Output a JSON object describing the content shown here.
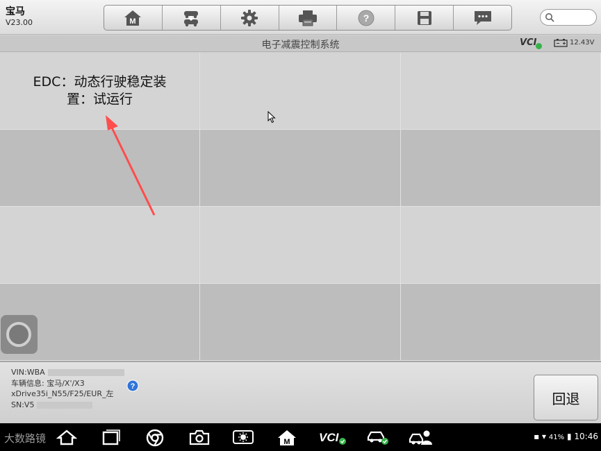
{
  "app": {
    "name": "宝马",
    "version": "V23.00"
  },
  "toolbar": {
    "buttons": [
      {
        "icon": "home-icon"
      },
      {
        "icon": "vehicle-swap-icon"
      },
      {
        "icon": "settings-gear-icon"
      },
      {
        "icon": "printer-icon"
      },
      {
        "icon": "help-icon"
      },
      {
        "icon": "save-icon"
      },
      {
        "icon": "message-icon"
      }
    ]
  },
  "search": {
    "placeholder": ""
  },
  "titlebar": {
    "title": "电子减震控制系统",
    "vci": "VCI",
    "voltage": "12.43V"
  },
  "grid": {
    "cells": [
      {
        "label": "EDC：动态行驶稳定装置：试运行"
      },
      {
        "label": ""
      },
      {
        "label": ""
      },
      {
        "label": ""
      },
      {
        "label": ""
      },
      {
        "label": ""
      },
      {
        "label": ""
      },
      {
        "label": ""
      },
      {
        "label": ""
      },
      {
        "label": ""
      },
      {
        "label": ""
      },
      {
        "label": ""
      }
    ]
  },
  "info": {
    "vin": "VIN:WBA",
    "vehicle_line1": "车辆信息: 宝马/X'/X3",
    "vehicle_line2": "xDrive35i_N55/F25/EUR_左",
    "sn": "SN:V5"
  },
  "back_button": {
    "label": "回退"
  },
  "navbar": {
    "watermark": "大数路镜",
    "battery_pct": "41%",
    "time": "10:46",
    "icons": [
      "back-icon",
      "home-icon",
      "recent-apps-icon",
      "chrome-icon",
      "camera-icon",
      "brightness-icon",
      "maxisys-icon",
      "vci-icon",
      "car-icon",
      "car-person-icon"
    ]
  },
  "colors": {
    "accent": "#35b34a",
    "annotation_arrow": "#ff4d4d"
  }
}
